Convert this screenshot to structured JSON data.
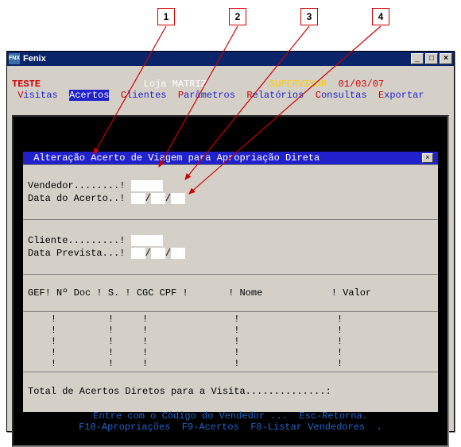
{
  "callouts": {
    "c1": "1",
    "c2": "2",
    "c3": "3",
    "c4": "4"
  },
  "window": {
    "title": "Fenix",
    "min": "_",
    "max": "□",
    "close": "×"
  },
  "header": {
    "brand": "TESTE",
    "store": "Loja MATRIZ",
    "user": "SUPERVISOR",
    "date": "01/03/07"
  },
  "menu": {
    "visitas": {
      "hot": "V",
      "rest": "isitas"
    },
    "acertos": {
      "hot": "A",
      "rest": "certos"
    },
    "clientes": {
      "hot": "C",
      "rest": "lientes"
    },
    "parametros": {
      "hot": "P",
      "rest": "arâmetros"
    },
    "relatorios": {
      "hot": "R",
      "rest": "elatórios"
    },
    "consultas": {
      "hot": "C",
      "rest": "onsultas"
    },
    "exportar": {
      "hot": "E",
      "rest": "xportar"
    }
  },
  "dialog": {
    "title": " Alteração Acerto de Viagem para Apropriação Direta",
    "close": "×",
    "labels": {
      "vendedor": "Vendedor........!",
      "data_acerto": "Data do Acerto..!",
      "cliente": "Cliente.........!",
      "data_prevista": "Data Prevista...!"
    },
    "fields": {
      "vendedor": "",
      "data_acerto_d": "",
      "data_acerto_m": "",
      "data_acerto_y": "",
      "cliente": "",
      "data_prevista_d": "",
      "data_prevista_m": "",
      "data_prevista_y": ""
    },
    "sep": "/",
    "headers": {
      "gef": "GEF!",
      "ndoc": " Nº Doc !",
      "s": " S. !",
      "cgccpf": " CGC CPF !",
      "nome": " Nome",
      "valor": " Valor"
    },
    "rows_sep": "!",
    "total_label": "Total de Acertos Diretos para a Visita..............:"
  },
  "footer": {
    "line1": "Entre com o Código do Vendedor ...  Esc-Retorna.",
    "line2": "F10-Apropriações  F9-Acertos  F8-Listar Vendedores  ."
  }
}
